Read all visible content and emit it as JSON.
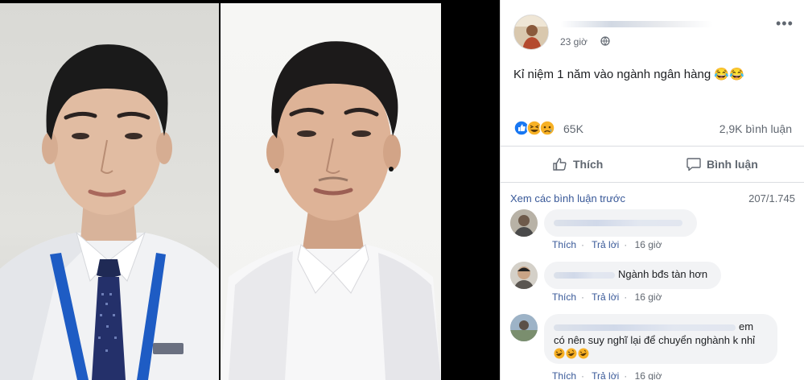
{
  "post": {
    "time": "23 giờ",
    "text": "Kỉ niệm 1 năm vào ngành ngân hàng 😂😂",
    "reaction_count": "65K",
    "comment_count": "2,9K bình luận"
  },
  "actions": {
    "like_label": "Thích",
    "comment_label": "Bình luận"
  },
  "comments_header": {
    "view_previous": "Xem các bình luận trước",
    "page_count": "207/1.745"
  },
  "comments": [
    {
      "text": "",
      "like": "Thích",
      "reply": "Trả lời",
      "time": "16 giờ"
    },
    {
      "text": "Ngành bđs tàn hơn",
      "like": "Thích",
      "reply": "Trả lời",
      "time": "16 giờ"
    },
    {
      "text_line1": "em",
      "text_line2": "có nên suy nghĩ lại để chuyển nghành k nhỉ",
      "like": "Thích",
      "reply": "Trả lời",
      "time": "16 giờ"
    }
  ],
  "icons": {
    "more": "more-icon",
    "globe": "globe-icon",
    "like": "thumb-up-icon",
    "comment": "speech-bubble-icon"
  },
  "colors": {
    "link": "#385898",
    "muted": "#606770",
    "bubble": "#f2f3f5",
    "like_blue": "#1877f2",
    "reaction_yellow": "#f7b125"
  }
}
